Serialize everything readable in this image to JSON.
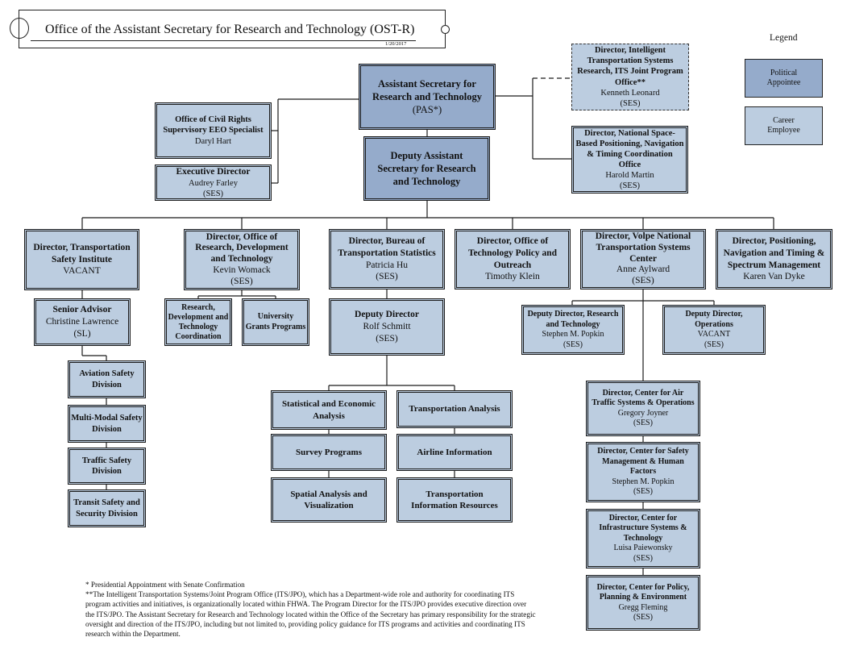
{
  "header": {
    "title": "Office of the Assistant Secretary for  Research and Technology (OST-R)",
    "date": "1/20/2017"
  },
  "legend": {
    "label": "Legend",
    "items": [
      {
        "line1": "Political",
        "line2": "Appointee",
        "color": "#95abcb"
      },
      {
        "line1": "Career",
        "line2": "Employee",
        "color": "#bccde0"
      }
    ]
  },
  "colors": {
    "political": "#95abcb",
    "career": "#bccde0",
    "line": "#1a1a1a"
  },
  "nodes": {
    "asst_sec": {
      "title": "Assistant Secretary for Research and Technology",
      "name": "(PAS*)"
    },
    "deputy_asst_sec": {
      "title": "Deputy Assistant Secretary for Research and Technology"
    },
    "civil_rights": {
      "title": "Office of Civil Rights Supervisory EEO Specialist",
      "name": "Daryl Hart"
    },
    "exec_dir": {
      "title": "Executive Director",
      "name": "Audrey Farley",
      "grade": "(SES)"
    },
    "its_jpo": {
      "title": "Director, Intelligent Transportation Systems Research, ITS Joint Program Office**",
      "name": "Kenneth Leonard",
      "grade": "(SES)"
    },
    "pnt_coord": {
      "title": "Director, National Space-Based Positioning, Navigation & Timing Coordination Office",
      "name": "Harold Martin",
      "grade": "(SES)"
    },
    "tsi": {
      "title": "Director, Transportation Safety Institute",
      "name": "VACANT"
    },
    "rdt": {
      "title": "Director, Office of Research, Development and Technology",
      "name": "Kevin Womack",
      "grade": "(SES)"
    },
    "bts": {
      "title": "Director, Bureau of Transportation Statistics",
      "name": "Patricia Hu",
      "grade": "(SES)"
    },
    "tpo": {
      "title": "Director, Office of Technology Policy and Outreach",
      "name": "Timothy Klein"
    },
    "volpe": {
      "title": "Director, Volpe National Transportation Systems Center",
      "name": "Anne Aylward",
      "grade": "(SES)"
    },
    "pnt_spectrum": {
      "title": "Director, Positioning, Navigation and Timing & Spectrum Management",
      "name": "Karen Van Dyke"
    },
    "senior_advisor": {
      "title": "Senior Advisor",
      "name": "Christine Lawrence",
      "grade": "(SL)"
    },
    "aviation": {
      "title": "Aviation Safety Division"
    },
    "multimodal": {
      "title": "Multi-Modal Safety Division"
    },
    "traffic": {
      "title": "Traffic Safety Division"
    },
    "transit": {
      "title": "Transit Safety and Security Division"
    },
    "rdt_coord": {
      "title": "Research, Development and Technology Coordination"
    },
    "univ_grants": {
      "title": "University Grants Programs"
    },
    "bts_deputy": {
      "title": "Deputy Director",
      "name": "Rolf Schmitt",
      "grade": "(SES)"
    },
    "stat_econ": {
      "title": "Statistical and Economic Analysis"
    },
    "survey": {
      "title": "Survey Programs"
    },
    "spatial": {
      "title": "Spatial Analysis and Visualization"
    },
    "trans_analysis": {
      "title": "Transportation Analysis"
    },
    "airline": {
      "title": "Airline Information"
    },
    "trans_info": {
      "title": "Transportation Information Resources"
    },
    "volpe_dep_rt": {
      "title": "Deputy Director, Research and Technology",
      "name": "Stephen M. Popkin",
      "grade": "(SES)"
    },
    "volpe_dep_ops": {
      "title": "Deputy Director, Operations",
      "name": "VACANT",
      "grade": "(SES)"
    },
    "air_traffic": {
      "title": "Director, Center for Air Traffic Systems & Operations",
      "name": "Gregory Joyner",
      "grade": "(SES)"
    },
    "safety_mgmt": {
      "title": "Director, Center for Safety Management & Human Factors",
      "name": "Stephen M. Popkin",
      "grade": "(SES)"
    },
    "infrastructure": {
      "title": "Director, Center for Infrastructure Systems & Technology",
      "name": "Luisa Paiewonsky",
      "grade": "(SES)"
    },
    "policy_planning": {
      "title": "Director, Center for Policy, Planning & Environment",
      "name": "Gregg Fleming",
      "grade": "(SES)"
    }
  },
  "footnotes": [
    "* Presidential Appointment with Senate Confirmation",
    "**The Intelligent Transportation Systems/Joint Program Office (ITS/JPO), which has a Department-wide role and authority for coordinating ITS program activities and initiatives, is organizationally located within FHWA.  The Program Director for the ITS/JPO provides executive direction over the ITS/JPO. The Assistant Secretary for Research and Technology located within the Office of the Secretary has primary responsibility for the strategic oversight and direction of the ITS/JPO, including but not limited to, providing policy guidance for ITS programs and activities and coordinating ITS research within the Department."
  ]
}
